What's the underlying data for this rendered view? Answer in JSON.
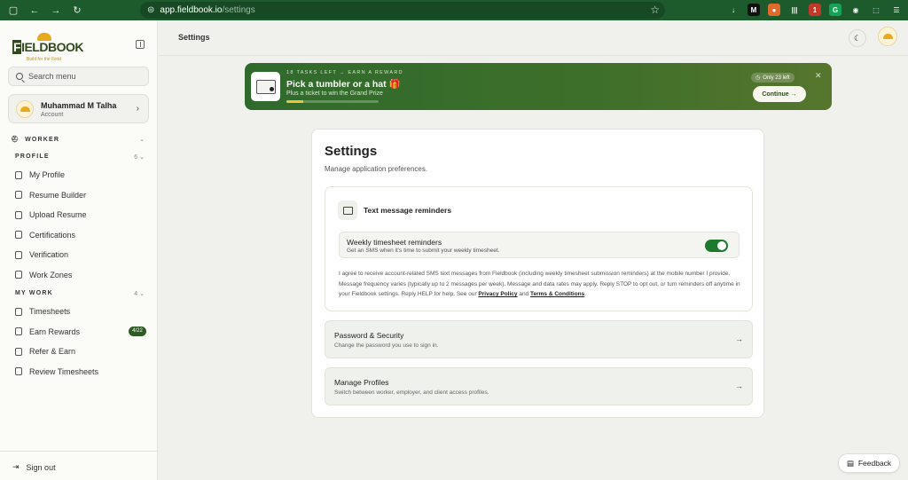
{
  "browser": {
    "url_host": "app.fieldbook.io",
    "url_path": "/settings",
    "nav_icons": [
      "sidebar-toggle-icon",
      "back-icon",
      "forward-icon",
      "reload-icon"
    ],
    "extensions": [
      {
        "name": "download-icon",
        "color": "#1d5a2c",
        "label": "↓"
      },
      {
        "name": "extension-m-icon",
        "color": "#111111",
        "label": "M"
      },
      {
        "name": "extension-orange-icon",
        "color": "#e06a2a",
        "label": "●"
      },
      {
        "name": "extension-bars-icon",
        "color": "#1d5a2c",
        "label": "|||"
      },
      {
        "name": "extension-red-badge-icon",
        "color": "#c0392b",
        "label": "1"
      },
      {
        "name": "grammarly-icon",
        "color": "#15a35a",
        "label": "G"
      },
      {
        "name": "extension-globe-icon",
        "color": "#1d5a2c",
        "label": "◉"
      },
      {
        "name": "extensions-puzzle-icon",
        "color": "#1d5a2c",
        "label": "⬚"
      },
      {
        "name": "menu-icon",
        "color": "#1d5a2c",
        "label": "☰"
      }
    ]
  },
  "sidebar": {
    "logo_word": "FIELDBOOK",
    "logo_tag": "Build for the Field",
    "search_placeholder": "Search menu",
    "account": {
      "name": "Muhammad M Talha",
      "role": "Account"
    },
    "role_section": "WORKER",
    "profile_section": {
      "label": "PROFILE",
      "count": "6"
    },
    "profile_items": [
      {
        "label": "My Profile",
        "icon": "user-icon"
      },
      {
        "label": "Resume Builder",
        "icon": "document-icon"
      },
      {
        "label": "Upload Resume",
        "icon": "cloud-upload-icon"
      },
      {
        "label": "Certifications",
        "icon": "certificate-icon"
      },
      {
        "label": "Verification",
        "icon": "shield-check-icon"
      },
      {
        "label": "Work Zones",
        "icon": "hard-hat-icon"
      }
    ],
    "work_section": {
      "label": "MY WORK",
      "count": "4"
    },
    "work_items": [
      {
        "label": "Timesheets",
        "icon": "clipboard-icon",
        "badge": ""
      },
      {
        "label": "Earn Rewards",
        "icon": "trophy-icon",
        "badge": "4/22"
      },
      {
        "label": "Refer & Earn",
        "icon": "gift-icon",
        "badge": ""
      },
      {
        "label": "Review Timesheets",
        "icon": "review-icon",
        "badge": ""
      }
    ],
    "signout_label": "Sign out"
  },
  "header": {
    "title": "Settings"
  },
  "banner": {
    "kicker": "18 TASKS LEFT → EARN A REWARD",
    "headline": "Pick a tumbler or a hat 🎁",
    "sub": "Plus a ticket to win the Grand Prize",
    "progress": 0.18,
    "pill": "Only 23 left",
    "cta": "Continue →",
    "close": "✕"
  },
  "settings": {
    "title": "Settings",
    "description": "Manage application preferences.",
    "sms": {
      "title": "Text message reminders",
      "row_title": "Weekly timesheet reminders",
      "row_desc": "Get an SMS when it's time to submit your weekly timesheet.",
      "enabled": true,
      "consent_text": "I agree to receive account-related SMS text messages from Fieldbook (including weekly timesheet submission reminders) at the mobile number I provide. Message frequency varies (typically up to 2 messages per week). Message and data rates may apply. Reply STOP to opt out, or turn reminders off anytime in your Fieldbook settings. Reply HELP for help. See our",
      "privacy_link": "Privacy Policy",
      "and_text": "and",
      "terms_link": "Terms & Conditions",
      "end_text": "."
    },
    "password": {
      "title": "Password & Security",
      "desc": "Change the password you use to sign in.",
      "arrow": "→"
    },
    "profiles": {
      "title": "Manage Profiles",
      "desc": "Switch between worker, employer, and client access profiles.",
      "arrow": "→"
    }
  },
  "feedback_label": "Feedback"
}
